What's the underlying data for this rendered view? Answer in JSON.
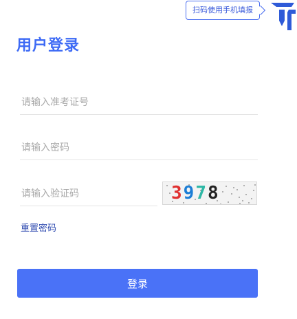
{
  "qr_tip": {
    "text": "扫码使用手机填报"
  },
  "icons": {
    "qr_corner": "qr-code-corner-icon"
  },
  "login": {
    "title": "用户登录",
    "id_field": {
      "placeholder": "请输入准考证号",
      "value": ""
    },
    "password_field": {
      "placeholder": "请输入密码",
      "value": ""
    },
    "captcha_field": {
      "placeholder": "请输入验证码",
      "value": ""
    },
    "captcha": {
      "digits": [
        "3",
        "9",
        "7",
        "8"
      ]
    },
    "reset_link": "重置密码",
    "submit_label": "登录"
  },
  "colors": {
    "accent": "#4a72f7",
    "title": "#3d6af5",
    "link": "#2f4bb0"
  }
}
